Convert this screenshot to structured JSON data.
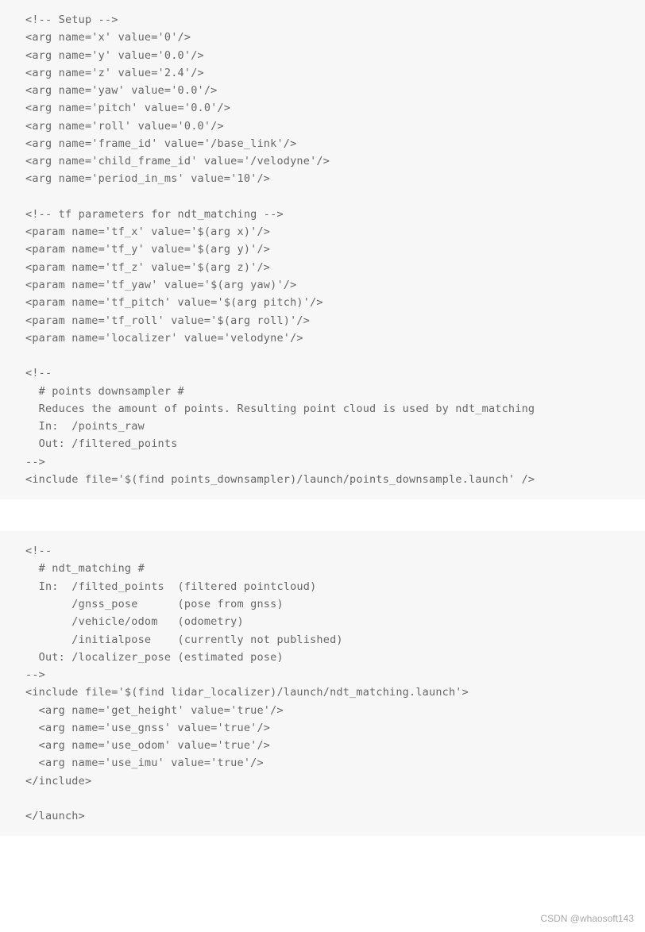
{
  "block1": "<!-- Setup -->\n<arg name='x' value='0'/>\n<arg name='y' value='0.0'/>\n<arg name='z' value='2.4'/>\n<arg name='yaw' value='0.0'/>\n<arg name='pitch' value='0.0'/>\n<arg name='roll' value='0.0'/>\n<arg name='frame_id' value='/base_link'/>\n<arg name='child_frame_id' value='/velodyne'/>\n<arg name='period_in_ms' value='10'/>\n\n<!-- tf parameters for ndt_matching -->\n<param name='tf_x' value='$(arg x)'/>\n<param name='tf_y' value='$(arg y)'/>\n<param name='tf_z' value='$(arg z)'/>\n<param name='tf_yaw' value='$(arg yaw)'/>\n<param name='tf_pitch' value='$(arg pitch)'/>\n<param name='tf_roll' value='$(arg roll)'/>\n<param name='localizer' value='velodyne'/>\n\n<!--\n  # points downsampler #\n  Reduces the amount of points. Resulting point cloud is used by ndt_matching\n  In:  /points_raw\n  Out: /filtered_points\n-->\n<include file='$(find points_downsampler)/launch/points_downsample.launch' />",
  "block2": "<!--\n  # ndt_matching #\n  In:  /filted_points  (filtered pointcloud)\n       /gnss_pose      (pose from gnss)\n       /vehicle/odom   (odometry)\n       /initialpose    (currently not published)\n  Out: /localizer_pose (estimated pose)\n-->\n<include file='$(find lidar_localizer)/launch/ndt_matching.launch'>\n  <arg name='get_height' value='true'/>\n  <arg name='use_gnss' value='true'/>\n  <arg name='use_odom' value='true'/>\n  <arg name='use_imu' value='true'/>\n</include>\n\n</launch>",
  "watermark": "CSDN @whaosoft143"
}
